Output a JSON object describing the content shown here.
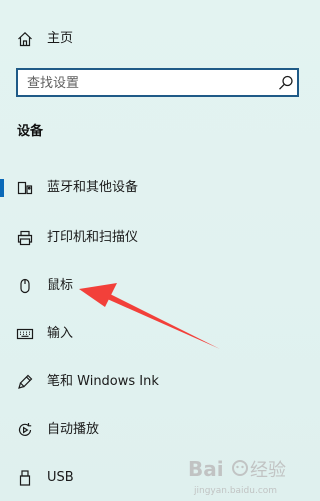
{
  "nav": {
    "home": {
      "label": "主页",
      "icon": "home-icon"
    }
  },
  "search": {
    "placeholder": "查找设置",
    "value": "",
    "icon": "search-icon"
  },
  "section": {
    "title": "设备"
  },
  "items": [
    {
      "label": "蓝牙和其他设备",
      "icon": "bluetooth-devices-icon",
      "active": true
    },
    {
      "label": "打印机和扫描仪",
      "icon": "printer-icon",
      "active": false
    },
    {
      "label": "鼠标",
      "icon": "mouse-icon",
      "active": false
    },
    {
      "label": "输入",
      "icon": "keyboard-icon",
      "active": false
    },
    {
      "label": "笔和 Windows Ink",
      "icon": "pen-icon",
      "active": false
    },
    {
      "label": "自动播放",
      "icon": "autoplay-icon",
      "active": false
    },
    {
      "label": "USB",
      "icon": "usb-icon",
      "active": false
    }
  ],
  "colors": {
    "accent": "#0b69b8",
    "search_border": "#1f5a87",
    "background": "#e2f2f0",
    "annotation_arrow": "#f2403a"
  },
  "watermark": {
    "brand": "Bai",
    "suffix": "经验",
    "url": "jingyan.baidu.com"
  }
}
